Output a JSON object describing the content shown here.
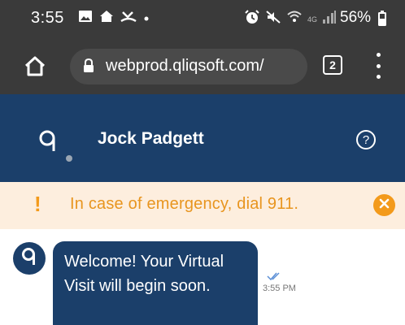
{
  "status_bar": {
    "time": "3:55",
    "left_icons": [
      "image-icon",
      "home-notification-icon",
      "missed-call-icon",
      "dot-icon"
    ],
    "right_icons": [
      "alarm-icon",
      "mute-icon",
      "wifi-icon",
      "signal-icon"
    ],
    "network_label": "4G",
    "battery": "56%"
  },
  "browser": {
    "url": "webprod.qliqsoft.com/",
    "tab_count": "2",
    "icons": [
      "home-icon",
      "lock-icon",
      "tabs-icon",
      "menu-icon"
    ]
  },
  "header": {
    "user_name": "Jock Padgett",
    "help_label": "?",
    "icons": [
      "qliq-logo-icon",
      "help-icon"
    ]
  },
  "banner": {
    "bang": "!",
    "text": "In case of emergency, dial 911.",
    "icons": [
      "exclamation-icon",
      "close-icon"
    ]
  },
  "chat": {
    "messages": [
      {
        "text": "Welcome! Your Virtual Visit will begin soon.",
        "time": "3:55 PM",
        "status": "read"
      }
    ]
  },
  "colors": {
    "status_bar_bg": "#3a3a3a",
    "header_bg": "#1b3f6a",
    "banner_bg": "#fdeede",
    "banner_accent": "#f39a1b"
  }
}
